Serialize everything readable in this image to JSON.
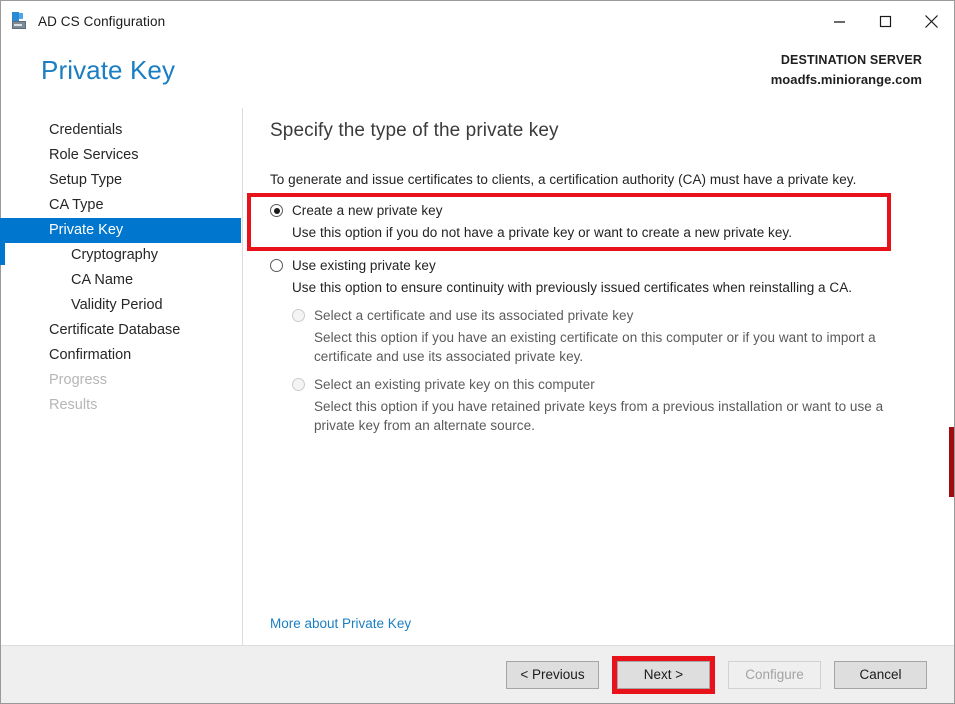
{
  "window": {
    "title": "AD CS Configuration",
    "app_icon": "server-icon",
    "controls": {
      "minimize": "minimize-icon",
      "maximize": "maximize-icon",
      "close": "close-icon"
    }
  },
  "header": {
    "page_title": "Private Key",
    "destination_label": "DESTINATION SERVER",
    "destination_server": "moadfs.miniorange.com"
  },
  "sidebar": {
    "items": [
      {
        "label": "Credentials",
        "level": 0,
        "state": "normal"
      },
      {
        "label": "Role Services",
        "level": 0,
        "state": "normal"
      },
      {
        "label": "Setup Type",
        "level": 0,
        "state": "normal"
      },
      {
        "label": "CA Type",
        "level": 0,
        "state": "normal"
      },
      {
        "label": "Private Key",
        "level": 0,
        "state": "selected"
      },
      {
        "label": "Cryptography",
        "level": 1,
        "state": "normal"
      },
      {
        "label": "CA Name",
        "level": 1,
        "state": "normal"
      },
      {
        "label": "Validity Period",
        "level": 1,
        "state": "normal"
      },
      {
        "label": "Certificate Database",
        "level": 0,
        "state": "normal"
      },
      {
        "label": "Confirmation",
        "level": 0,
        "state": "normal"
      },
      {
        "label": "Progress",
        "level": 0,
        "state": "disabled"
      },
      {
        "label": "Results",
        "level": 0,
        "state": "disabled"
      }
    ]
  },
  "main": {
    "heading": "Specify the type of the private key",
    "intro": "To generate and issue certificates to clients, a certification authority (CA) must have a private key.",
    "option_create": {
      "label": "Create a new private key",
      "description": "Use this option if you do not have a private key or want to create a new private key.",
      "checked": true,
      "highlighted": true
    },
    "option_existing": {
      "label": "Use existing private key",
      "description": "Use this option to ensure continuity with previously issued certificates when reinstalling a CA.",
      "checked": false,
      "sub_options": [
        {
          "label": "Select a certificate and use its associated private key",
          "description": "Select this option if you have an existing certificate on this computer or if you want to import a certificate and use its associated private key.",
          "checked": false,
          "disabled": true
        },
        {
          "label": "Select an existing private key on this computer",
          "description": "Select this option if you have retained private keys from a previous installation or want to use a private key from an alternate source.",
          "checked": false,
          "disabled": true
        }
      ]
    },
    "more_link": "More about Private Key"
  },
  "footer": {
    "previous": "< Previous",
    "next": "Next >",
    "configure": "Configure",
    "cancel": "Cancel",
    "next_highlighted": true,
    "configure_disabled": true
  },
  "colors": {
    "accent_blue": "#0076cf",
    "title_blue": "#1b7ec2",
    "highlight_red": "#e8121b",
    "edge_mark_red": "#a00c10",
    "footer_bg": "#efefef"
  }
}
